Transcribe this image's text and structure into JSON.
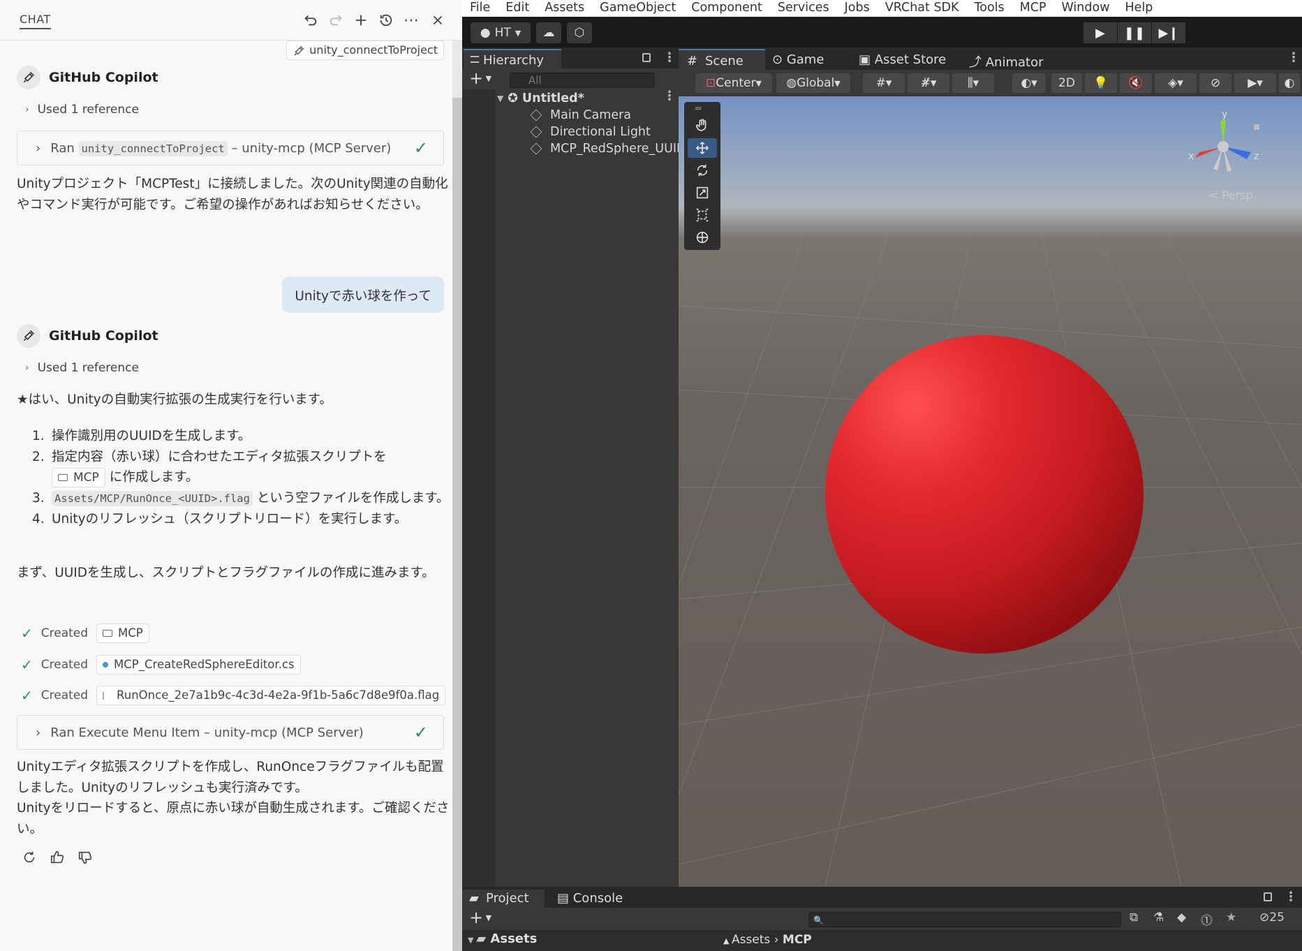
{
  "chat": {
    "title": "CHAT",
    "tool_chip": "unity_connectToProject",
    "agent_name": "GitHub Copilot",
    "used_ref": "Used 1 reference",
    "ran1_prefix": "Ran",
    "ran1_code": "unity_connectToProject",
    "ran1_suffix": "– unity-mcp (MCP Server)",
    "msg1": "Unityプロジェクト「MCPTest」に接続しました。次のUnity関連の自動化やコマンド実行が可能です。ご希望の操作があればお知らせください。",
    "user_msg": "Unityで赤い球を作って",
    "msg2": "★はい、Unityの自動実行拡張の生成実行を行います。",
    "steps": {
      "s1": "操作識別用のUUIDを生成します。",
      "s2a": "指定内容（赤い球）に合わせたエディタ拡張スクリプトを",
      "s2_chip": "MCP",
      "s2b": "に作成します。",
      "s3_code": "Assets/MCP/RunOnce_<UUID>.flag",
      "s3": "という空ファイルを作成します。",
      "s4": "Unityのリフレッシュ（スクリプトリロード）を実行します。"
    },
    "msg3": "まず、UUIDを生成し、スクリプトとフラグファイルの作成に進みます。",
    "created_label": "Created",
    "created1": "MCP",
    "created2": "MCP_CreateRedSphereEditor.cs",
    "created3": "RunOnce_2e7a1b9c-4c3d-4e2a-9f1b-5a6c7d8e9f0a.flag",
    "ran2": "Ran Execute Menu Item – unity-mcp (MCP Server)",
    "msg4": "Unityエディタ拡張スクリプトを作成し、RunOnceフラグファイルも配置しました。Unityのリフレッシュも実行済みです。",
    "msg5": "Unityをリロードすると、原点に赤い球が自動生成されます。ご確認ください。"
  },
  "unity": {
    "menu": [
      "File",
      "Edit",
      "Assets",
      "GameObject",
      "Component",
      "Services",
      "Jobs",
      "VRChat SDK",
      "Tools",
      "MCP",
      "Window",
      "Help"
    ],
    "account": "HT",
    "hierarchy": {
      "tab": "Hierarchy",
      "search_placeholder": "All",
      "scene_name": "Untitled*",
      "items": [
        "Main Camera",
        "Directional Light",
        "MCP_RedSphere_UUII"
      ]
    },
    "scene_tabs": [
      "Scene",
      "Game",
      "Asset Store",
      "Animator"
    ],
    "pivot": "Center",
    "space": "Global",
    "mode2d": "2D",
    "persp": "< Persp",
    "gizmo_axes": {
      "x": "x",
      "y": "y",
      "z": "z"
    },
    "project": {
      "tabs": [
        "Project",
        "Console"
      ],
      "root": "Assets",
      "crumb1": "Assets",
      "crumb2": "MCP",
      "hidden_count": "25"
    }
  }
}
